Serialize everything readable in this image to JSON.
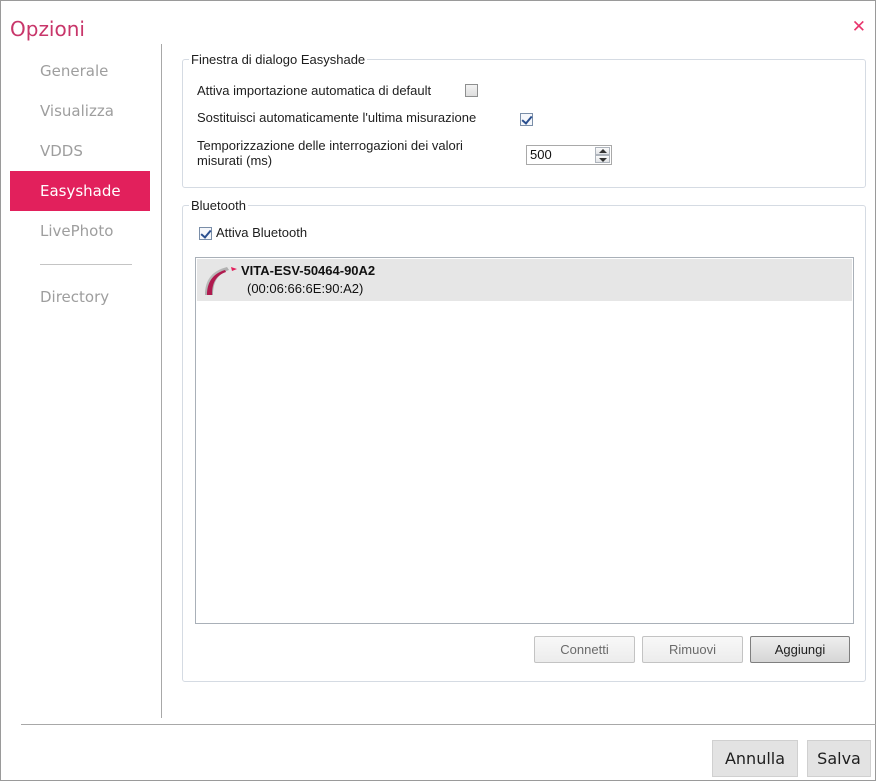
{
  "window": {
    "title": "Opzioni",
    "close_symbol": "✕",
    "accent_color": "#e2205c"
  },
  "sidebar": {
    "items": [
      {
        "label": "Generale",
        "active": false
      },
      {
        "label": "Visualizza",
        "active": false
      },
      {
        "label": "VDDS",
        "active": false
      },
      {
        "label": "Easyshade",
        "active": true
      },
      {
        "label": "LivePhoto",
        "active": false
      }
    ],
    "extra_item": {
      "label": "Directory"
    }
  },
  "easyshade_group": {
    "legend": "Finestra di dialogo Easyshade",
    "auto_import_label": "Attiva importazione automatica di default",
    "auto_import_checked": false,
    "replace_last_label": "Sostituisci automaticamente l'ultima misurazione",
    "replace_last_checked": true,
    "polling_label_line1": "Temporizzazione delle interrogazioni dei valori",
    "polling_label_line2": "misurati (ms)",
    "polling_value": "500"
  },
  "bluetooth_group": {
    "legend": "Bluetooth",
    "enable_label": "Attiva Bluetooth",
    "enable_checked": true,
    "devices": [
      {
        "name": "VITA-ESV-50464-90A2",
        "mac": "(00:06:66:6E:90:A2)",
        "icon": "easyshade-device-icon"
      }
    ],
    "buttons": {
      "connect": "Connetti",
      "remove": "Rimuovi",
      "add": "Aggiungi"
    }
  },
  "footer": {
    "cancel": "Annulla",
    "save": "Salva"
  }
}
